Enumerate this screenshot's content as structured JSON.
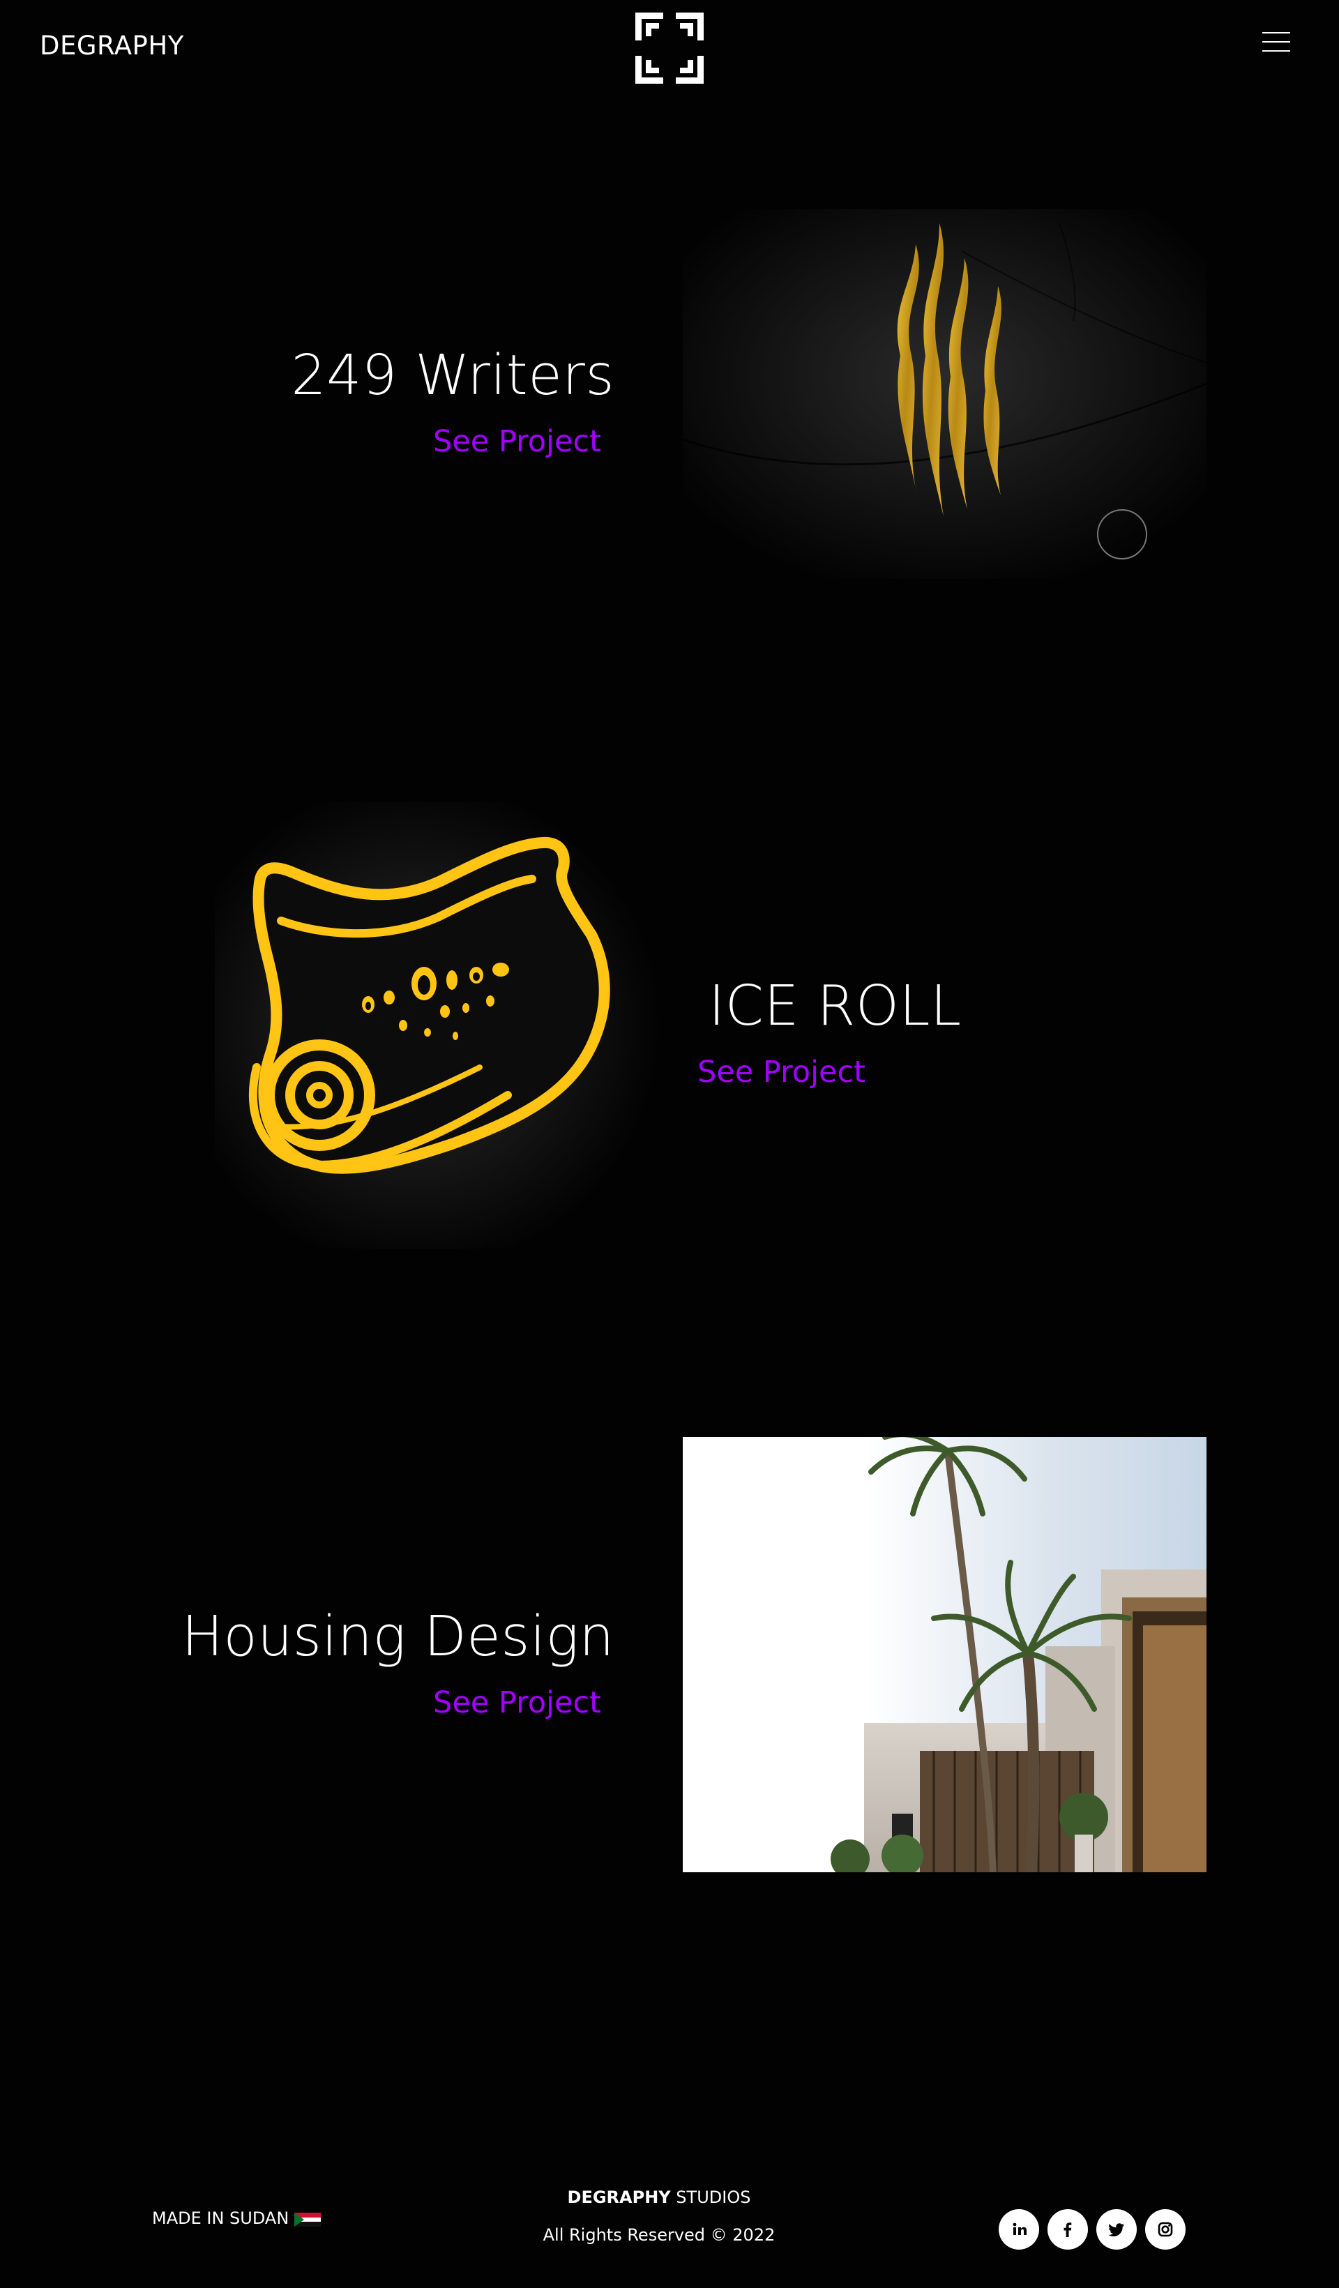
{
  "header": {
    "brand": "DEGRAPHY",
    "logo_icon": "degraphy-frame-logo-icon",
    "menu_icon": "hamburger-menu-icon"
  },
  "projects": [
    {
      "title": "249 Writers",
      "link_label": "See Project",
      "image": "claw-marks-gold-on-black"
    },
    {
      "title": "ICE ROLL",
      "link_label": "See Project",
      "image": "ice-roll-yellow-logo"
    },
    {
      "title": "Housing Design",
      "link_label": "See Project",
      "image": "modern-house-with-palm-trees"
    }
  ],
  "footer": {
    "made_in": "MADE IN SUDAN",
    "studio_brand": "DEGRAPHY",
    "studio_suffix": "STUDIOS",
    "rights": "All Rights Reserved © 2022",
    "socials": [
      "linkedin-icon",
      "facebook-icon",
      "twitter-icon",
      "instagram-icon"
    ]
  },
  "colors": {
    "background": "#020202",
    "text": "#ffffff",
    "accent_link": "#a100ff",
    "logo_yellow": "#ffc414"
  }
}
